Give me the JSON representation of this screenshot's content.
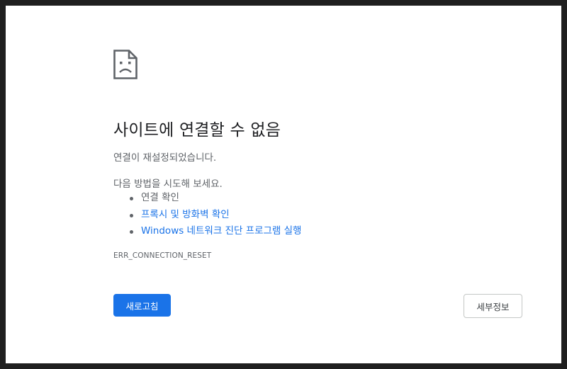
{
  "error_page": {
    "icon": "sad-document-icon",
    "title": "사이트에 연결할 수 없음",
    "subtitle": "연결이 재설정되었습니다.",
    "try_heading": "다음 방법을 시도해 보세요.",
    "suggestions": [
      {
        "label": "연결 확인",
        "is_link": false
      },
      {
        "label": "프록시 및 방화벽 확인",
        "is_link": true
      },
      {
        "label": "Windows 네트워크 진단 프로그램 실행",
        "is_link": true
      }
    ],
    "error_code": "ERR_CONNECTION_RESET",
    "reload_label": "새로고침",
    "details_label": "세부정보"
  },
  "colors": {
    "accent": "#1a73e8",
    "title_text": "#202124",
    "body_text": "#5f6368",
    "frame_background": "#1f1f1f"
  }
}
